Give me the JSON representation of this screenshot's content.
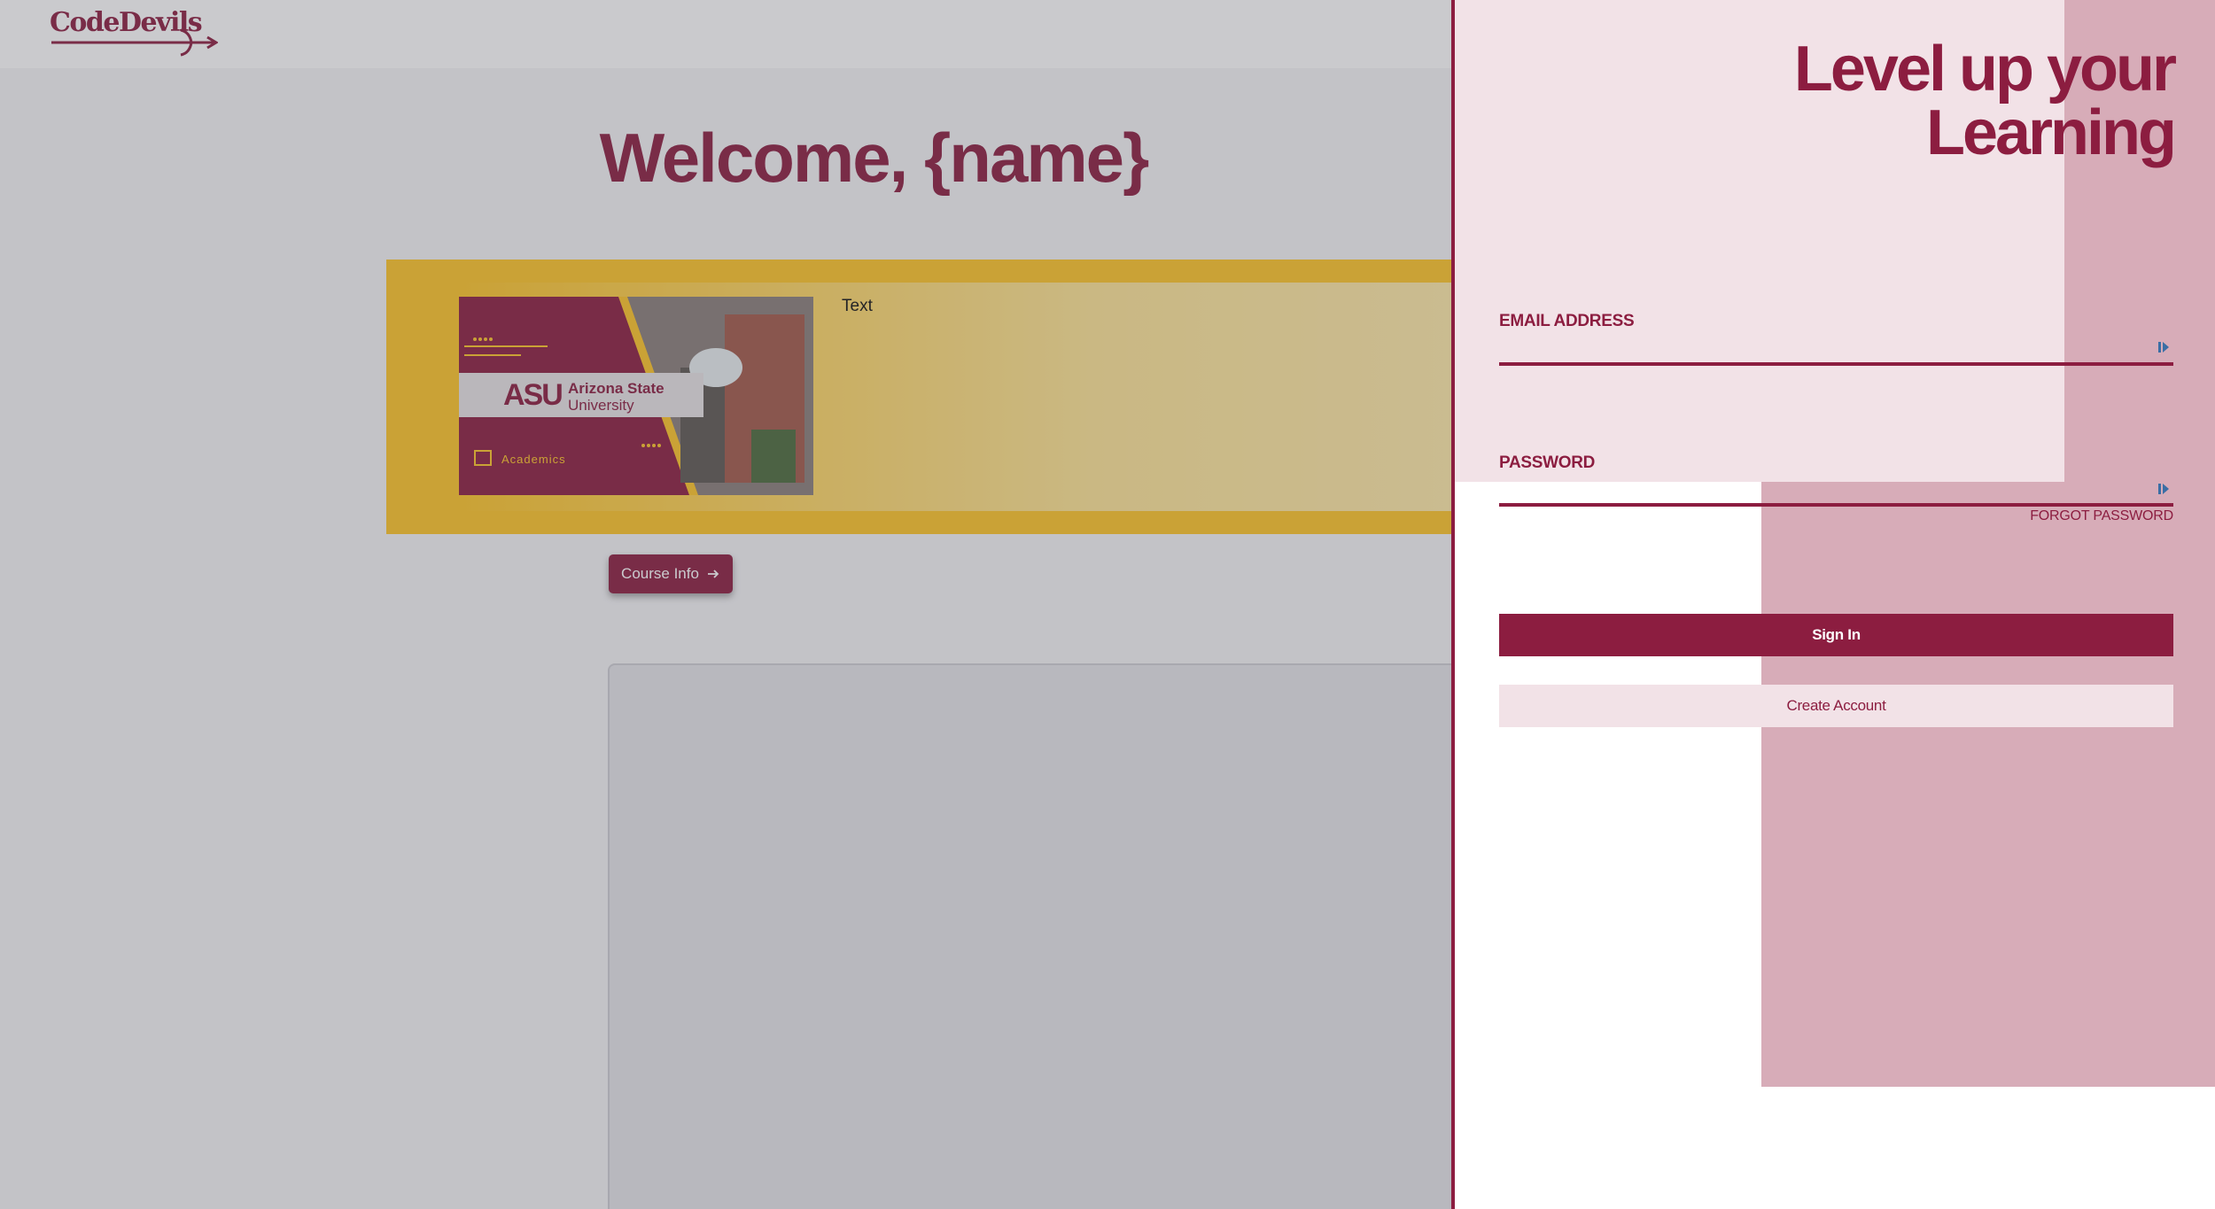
{
  "header": {
    "logo_text": "CodeDevils"
  },
  "main": {
    "welcome": "Welcome, {name}",
    "course": {
      "banner_brand_line1": "Arizona State",
      "banner_brand_line2": "University",
      "banner_tag": "Academics",
      "text": "Text"
    },
    "course_info_label": "Course Info"
  },
  "signin": {
    "headline_line1": "Level up your",
    "headline_line2": "Learning",
    "email_label": "EMAIL ADDRESS",
    "email_value": "",
    "password_label": "PASSWORD",
    "password_value": "",
    "forgot_label": "FORGOT PASSWORD",
    "signin_label": "Sign In",
    "create_label": "Create Account"
  },
  "colors": {
    "maroon": "#8c1d40",
    "gold": "#ffc627",
    "blush": "#f2e2e7",
    "rose": "#d7acb8"
  },
  "icons": {
    "email_field_icon": "password-manager-icon",
    "password_field_icon": "password-manager-icon",
    "course_info_icon": "arrow-right-icon"
  }
}
